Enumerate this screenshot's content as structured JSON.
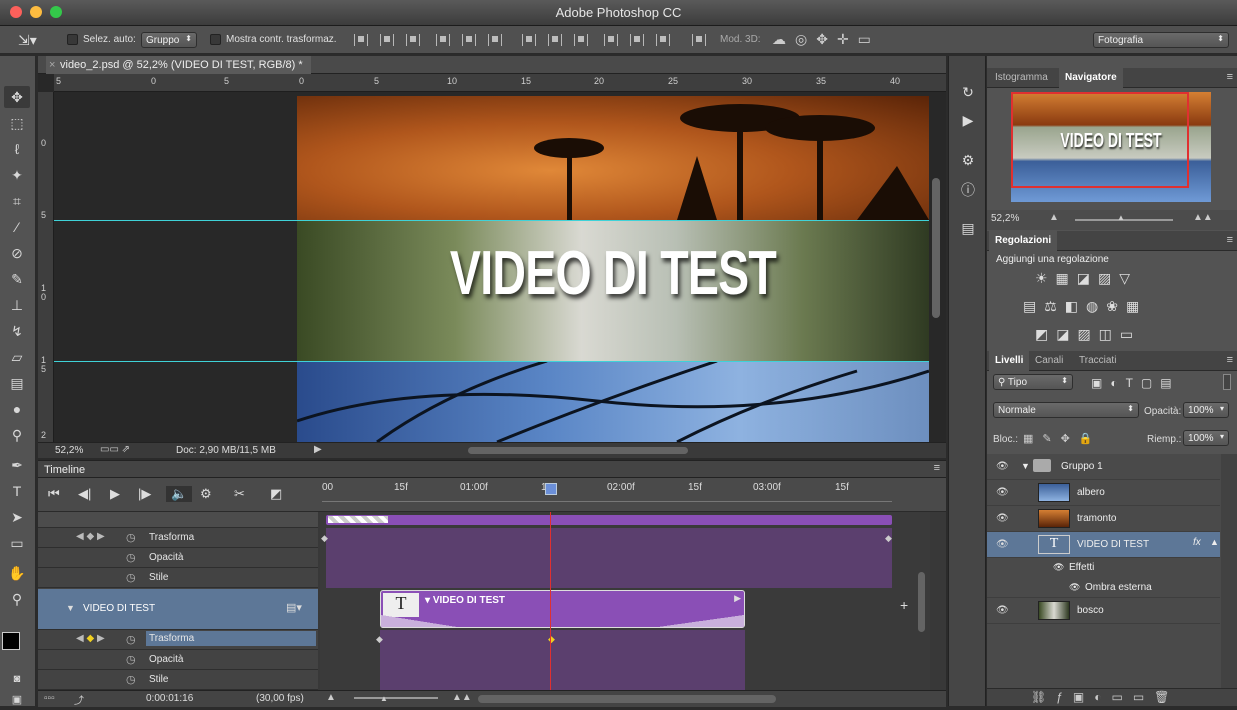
{
  "app": {
    "title": "Adobe Photoshop CC"
  },
  "options": {
    "auto_select_label": "Selez. auto:",
    "auto_select_value": "Gruppo",
    "show_transform_label": "Mostra contr. trasformaz.",
    "mode3d_label": "Mod. 3D:",
    "workspace_value": "Fotografia"
  },
  "document": {
    "tab_title": "video_2.psd @ 52,2% (VIDEO DI TEST, RGB/8) *",
    "canvas_text": "VIDEO DI TEST",
    "ruler_h": [
      "5",
      "0",
      "5",
      "0",
      "5",
      "10",
      "15",
      "20",
      "25",
      "30",
      "35",
      "40"
    ],
    "ruler_v": [
      "0",
      "5",
      "1 0",
      "1 5",
      "2"
    ],
    "zoom": "52,2%",
    "doc_info": "Doc: 2,90 MB/11,5 MB"
  },
  "timeline": {
    "panel_title": "Timeline",
    "ruler": [
      "00",
      "15f",
      "01:00f",
      "1",
      "02:00f",
      "15f",
      "03:00f",
      "15f"
    ],
    "rows": [
      {
        "label": "Trasforma"
      },
      {
        "label": "Opacità"
      },
      {
        "label": "Stile"
      }
    ],
    "layer_name": "VIDEO DI TEST",
    "clip_label": "VIDEO DI TEST",
    "rows2": [
      {
        "label": "Trasforma"
      },
      {
        "label": "Opacità"
      },
      {
        "label": "Stile"
      }
    ],
    "timecode": "0:00:01:16",
    "fps": "(30,00 fps)"
  },
  "navigator": {
    "tab1": "Istogramma",
    "tab2": "Navigatore",
    "image_text": "VIDEO DI TEST",
    "zoom": "52,2%"
  },
  "adjustments": {
    "title": "Regolazioni",
    "subtitle": "Aggiungi una regolazione"
  },
  "layers": {
    "tab1": "Livelli",
    "tab2": "Canali",
    "tab3": "Tracciati",
    "filter_value": "Tipo",
    "blend_mode": "Normale",
    "opacity_label": "Opacità:",
    "opacity_value": "100%",
    "lock_label": "Bloc.:",
    "fill_label": "Riemp.:",
    "fill_value": "100%",
    "items": [
      {
        "name": "Gruppo 1"
      },
      {
        "name": "albero"
      },
      {
        "name": "tramonto"
      },
      {
        "name": "VIDEO DI TEST"
      },
      {
        "name": "Effetti"
      },
      {
        "name": "Ombra esterna"
      },
      {
        "name": "bosco"
      }
    ]
  },
  "colors": {
    "playhead": "#e03030",
    "guide": "#3fd2d8",
    "clip": "#8a4fb6",
    "selection": "#5d7797"
  }
}
